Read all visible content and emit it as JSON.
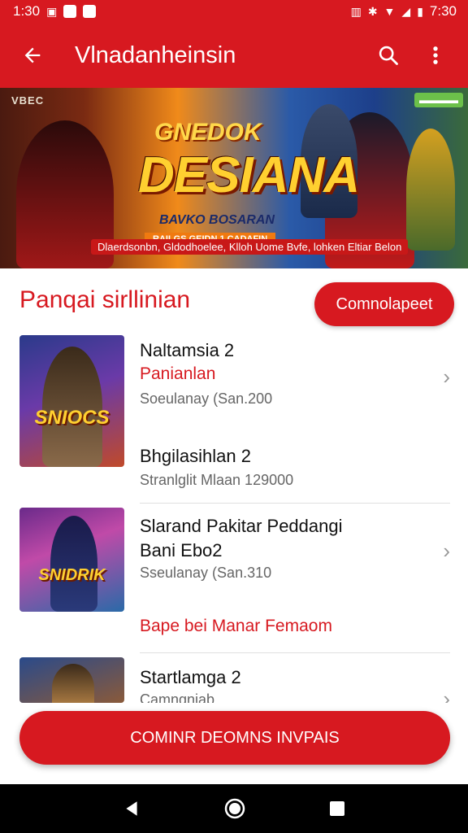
{
  "status_bar": {
    "time_left": "1:30",
    "time_right": "7:30",
    "bg": "#d71920"
  },
  "app_bar": {
    "title": "Vlnadanheinsin",
    "icons": [
      "arrow-left-icon",
      "search-icon",
      "more-vert-icon"
    ]
  },
  "hero": {
    "tag_left": "VBEC",
    "subtitle_top": "GNEDOK",
    "title": "DESIANA",
    "sub": "BAVKO BOSARAN",
    "strip": "RAILGS GEIDN 1 CADAFIN",
    "caption": "Dlaerdsonbn, Gldodhoelee, Klloh Uome Bvfe, lohken Eltiar Belon"
  },
  "section": {
    "title": "Panqai sirllinian",
    "button_label": "Comnolapeet"
  },
  "games": [
    {
      "name": "Naltamsia 2",
      "category": "Panianlan",
      "meta": "Soeulanay (San.200",
      "thumb_label": "SNIOCS"
    },
    {
      "name": "Bhgilasihlan 2",
      "meta": "Stranlglit Mlaan 129000"
    },
    {
      "name": "Slarand Pakitar Peddangi",
      "name2": "Bani Ebo2",
      "meta": "Sseulanay (San.310",
      "link": "Bape bei Manar Femaom",
      "thumb_label": "SNIDRIK"
    },
    {
      "name": "Startlamga 2",
      "meta": "Camngniab"
    }
  ],
  "cta": {
    "label": "COMINR DEOMNS INVPAIS"
  },
  "nav": {
    "icons": [
      "back-triangle-icon",
      "home-circle-icon",
      "recents-square-icon"
    ]
  },
  "colors": {
    "accent": "#d71920",
    "text": "#111111",
    "meta": "#666666"
  }
}
